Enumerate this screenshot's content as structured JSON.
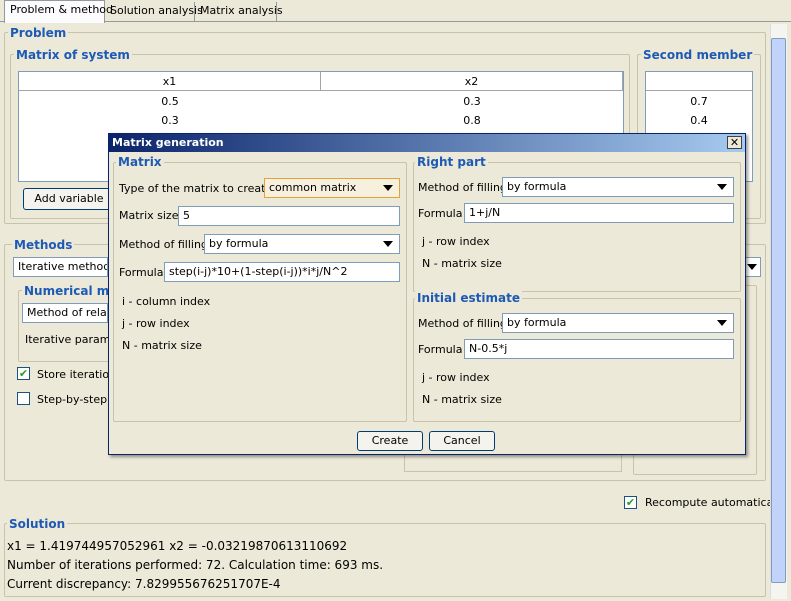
{
  "tabs": [
    {
      "label": "Problem & method"
    },
    {
      "label": "Solution analysis"
    },
    {
      "label": "Matrix analysis"
    }
  ],
  "problem": {
    "title": "Problem",
    "matrix": {
      "title": "Matrix of system",
      "headers": [
        "x1",
        "x2"
      ],
      "rows": [
        [
          "0.5",
          "0.3"
        ],
        [
          "0.3",
          "0.8"
        ]
      ],
      "add_variable": "Add variable"
    },
    "second_member": {
      "title": "Second member",
      "values": [
        "0.7",
        "0.4"
      ]
    }
  },
  "methods": {
    "title": "Methods",
    "method_select": "Iterative methods",
    "numerical_title": "Numerical meth",
    "relax_select": "Method of relaxa",
    "iter_params": "Iterative parame",
    "store_iterations": "Store iteration",
    "step_by_step": "Step-by-step r"
  },
  "recompute": "Recompute automatically",
  "solution": {
    "title": "Solution",
    "line1": "x1 = 1.419744957052961   x2 = -0.03219870613110692",
    "line2": "Number of iterations performed: 72.  Calculation time: 693 ms.",
    "line3": "Current discrepancy: 7.829955676251707E-4"
  },
  "dialog": {
    "title": "Matrix generation",
    "close": "✕",
    "matrix_group": {
      "title": "Matrix",
      "type_label": "Type of the matrix to create",
      "type_value": "common matrix",
      "size_label": "Matrix size",
      "size_value": "5",
      "filling_label": "Method of filling",
      "filling_value": "by formula",
      "formula_label": "Formula",
      "formula_value": "step(i-j)*10+(1-step(i-j))*i*j/N^2",
      "help1": "i - column index",
      "help2": "j - row index",
      "help3": "N - matrix size"
    },
    "right_part": {
      "title": "Right part",
      "filling_label": "Method of filling",
      "filling_value": "by formula",
      "formula_label": "Formula",
      "formula_value": "1+j/N",
      "help1": "j - row index",
      "help2": "N - matrix size"
    },
    "initial_estimate": {
      "title": "Initial estimate",
      "filling_label": "Method of filling",
      "filling_value": "by formula",
      "formula_label": "Formula",
      "formula_value": "N-0.5*j",
      "help1": "j - row index",
      "help2": "N - matrix size"
    },
    "create": "Create",
    "cancel": "Cancel"
  }
}
